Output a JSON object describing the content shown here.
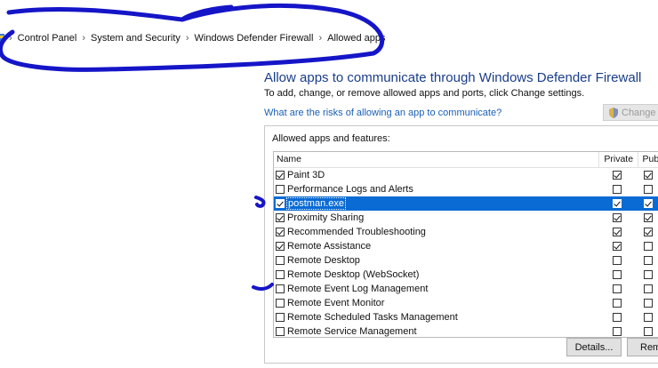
{
  "breadcrumb": {
    "items": [
      "Control Panel",
      "System and Security",
      "Windows Defender Firewall",
      "Allowed apps"
    ],
    "separator": "›"
  },
  "header": {
    "title": "Allow apps to communicate through Windows Defender Firewall",
    "subtitle": "To add, change, or remove allowed apps and ports, click Change settings.",
    "risk_link": "What are the risks of allowing an app to communicate?",
    "change_settings": "Change se"
  },
  "group": {
    "label": "Allowed apps and features:",
    "columns": {
      "name": "Name",
      "private": "Private",
      "public": "Publ"
    },
    "rows": [
      {
        "name": "Paint 3D",
        "enabled": true,
        "private": true,
        "public": true
      },
      {
        "name": "Performance Logs and Alerts",
        "enabled": false,
        "private": false,
        "public": false
      },
      {
        "name": "postman.exe",
        "enabled": true,
        "private": true,
        "public": true,
        "selected": true
      },
      {
        "name": "Proximity Sharing",
        "enabled": true,
        "private": true,
        "public": true
      },
      {
        "name": "Recommended Troubleshooting",
        "enabled": true,
        "private": true,
        "public": true
      },
      {
        "name": "Remote Assistance",
        "enabled": true,
        "private": true,
        "public": false
      },
      {
        "name": "Remote Desktop",
        "enabled": false,
        "private": false,
        "public": false
      },
      {
        "name": "Remote Desktop (WebSocket)",
        "enabled": false,
        "private": false,
        "public": false
      },
      {
        "name": "Remote Event Log Management",
        "enabled": false,
        "private": false,
        "public": false
      },
      {
        "name": "Remote Event Monitor",
        "enabled": false,
        "private": false,
        "public": false
      },
      {
        "name": "Remote Scheduled Tasks Management",
        "enabled": false,
        "private": false,
        "public": false
      },
      {
        "name": "Remote Service Management",
        "enabled": false,
        "private": false,
        "public": false
      }
    ]
  },
  "buttons": {
    "details": "Details...",
    "remove": "Remo"
  },
  "colors": {
    "accent": "#0a6bd4",
    "title": "#1a3d8a",
    "link": "#1a5fb4",
    "ink": "#1515c8"
  }
}
